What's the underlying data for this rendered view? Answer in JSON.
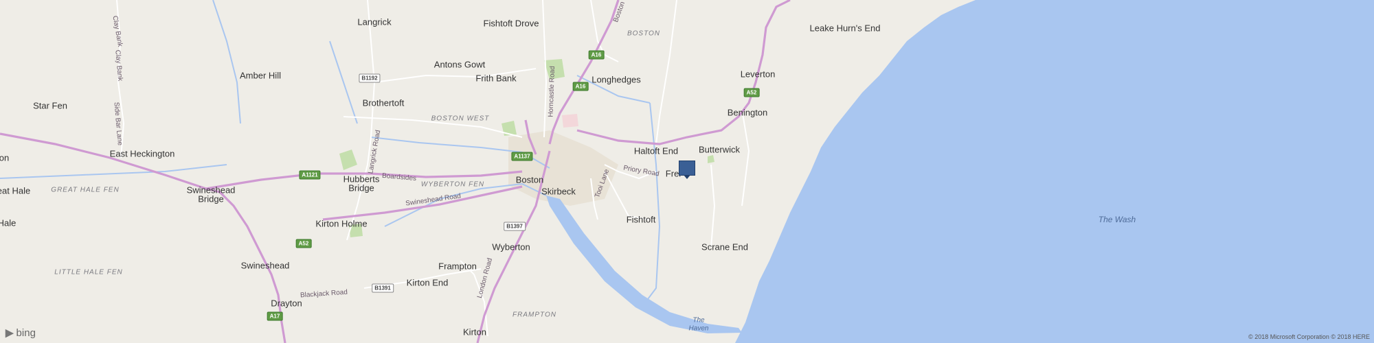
{
  "map": {
    "logo_text": "bing",
    "copyright": "© 2018 Microsoft Corporation © 2018 HERE",
    "marker": {
      "label": "Freiston",
      "color": "#3a5f95"
    },
    "colors": {
      "land": "#efede7",
      "sea": "#a9c6f0",
      "road_major": "#cf9ad2",
      "road_minor": "#ffffff",
      "river": "#a9c6f0",
      "park": "#c5dfae"
    }
  },
  "places": {
    "langrick": "Langrick",
    "fishtoft_drove": "Fishtoft Drove",
    "boston_region": "BOSTON",
    "leake_hurns_end": "Leake Hurn's End",
    "antons_gowt": "Antons Gowt",
    "leverton": "Leverton",
    "amber_hill": "Amber Hill",
    "frith_bank": "Frith Bank",
    "longhedges": "Longhedges",
    "star_fen": "Star Fen",
    "brothertoft": "Brothertoft",
    "benington": "Benington",
    "boston_west": "BOSTON WEST",
    "haltoft_end": "Haltoft End",
    "butterwick": "Butterwick",
    "heckington_partial": "on",
    "east_heckington": "East Heckington",
    "freiston_partial": "Frei",
    "great_hale_partial": "eat Hale",
    "great_hale_fen": "GREAT HALE FEN",
    "swineshead_bridge_1": "Swineshead",
    "swineshead_bridge_2": "Bridge",
    "hubberts_bridge_1": "Hubberts",
    "hubberts_bridge_2": "Bridge",
    "wyberton_fen": "WYBERTON FEN",
    "boston": "Boston",
    "skirbeck": "Skirbeck",
    "hale_partial": "Hale",
    "fishtoft": "Fishtoft",
    "the_wash": "The Wash",
    "kirton_holme": "Kirton Holme",
    "wyberton": "Wyberton",
    "scrane_end": "Scrane End",
    "swineshead": "Swineshead",
    "frampton": "Frampton",
    "little_hale_fen": "LITTLE HALE FEN",
    "kirton_end": "Kirton End",
    "drayton": "Drayton",
    "frampton_region": "FRAMPTON",
    "the_haven_1": "The",
    "the_haven_2": "Haven",
    "kirton": "Kirton"
  },
  "roads": {
    "clay_bank_1": "Clay Bank",
    "clay_bank_2": "Clay Bank",
    "side_bar_lane": "Side Bar Lane",
    "langrick_road": "Langrick Road",
    "boardsides": "Boardsides",
    "swineshead_road": "Swineshead Road",
    "horncastle_road": "Horncastle Road",
    "priory_road": "Priory Road",
    "tooi_lane": "Tooi Lane",
    "london_road": "London Road",
    "blackjack_road": "Blackjack Road",
    "boston_road": "Boston"
  },
  "shields": {
    "a16_1": "A16",
    "a16_2": "A16",
    "b1192": "B1192",
    "a52_1": "A52",
    "a1137": "A1137",
    "a1121": "A1121",
    "b1397": "B1397",
    "a52_2": "A52",
    "b1391": "B1391",
    "a17": "A17"
  }
}
